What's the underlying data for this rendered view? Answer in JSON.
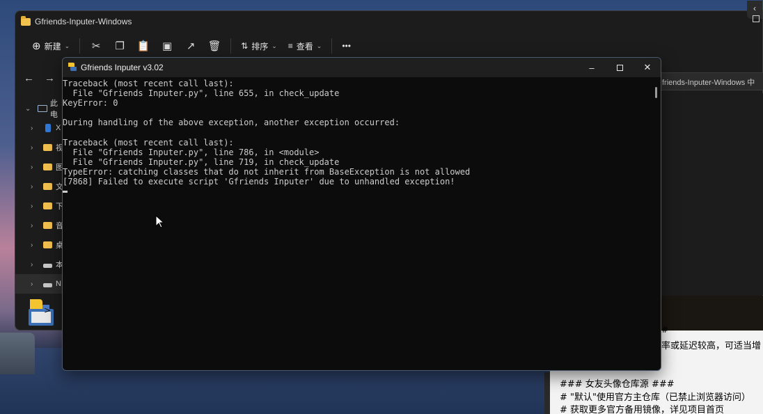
{
  "explorer": {
    "title": "Gfriends-Inputer-Windows",
    "toolbar": {
      "new_label": "新建",
      "sort_label": "排序",
      "view_label": "查看",
      "more_label": "•••"
    },
    "address_text": "friends-Inputer-Windows 中",
    "tree": [
      {
        "label": "此电",
        "icon": "pc-icon"
      },
      {
        "label": "X",
        "icon": "phone-icon"
      },
      {
        "label": "视",
        "icon": "folder-icon"
      },
      {
        "label": "图",
        "icon": "folder-icon"
      },
      {
        "label": "文",
        "icon": "folder-icon"
      },
      {
        "label": "下",
        "icon": "folder-icon"
      },
      {
        "label": "音",
        "icon": "folder-icon"
      },
      {
        "label": "桌",
        "icon": "folder-icon"
      },
      {
        "label": "本",
        "icon": "drive-icon"
      },
      {
        "label": "N",
        "icon": "drive-icon"
      }
    ]
  },
  "console": {
    "title": "Gfriends Inputer v3.02",
    "lines": [
      "Traceback (most recent call last):",
      "  File \"Gfriends Inputer.py\", line 655, in check_update",
      "KeyError: 0",
      "",
      "During handling of the above exception, another exception occurred:",
      "",
      "Traceback (most recent call last):",
      "  File \"Gfriends Inputer.py\", line 786, in <module>",
      "  File \"Gfriends Inputer.py\", line 719, in check_update",
      "TypeError: catching classes that do not inherit from BaseException is not allowed",
      "[7868] Failed to execute script 'Gfriends Inputer' due to unhandled exception!"
    ]
  },
  "notepad": {
    "lines": [
      "率或延迟较高，可适当增",
      "### 女友头像仓库源 ###",
      "# \"默认\"使用官方主仓库（已禁止浏览器访问）",
      "# 获取更多官方备用镜像，详见项目首页"
    ],
    "partial_top": "#"
  },
  "colors": {
    "console_bg": "#0c0c0c",
    "console_text": "#cccccc",
    "explorer_bg": "#1c1c1c",
    "folder": "#f2c14e"
  }
}
